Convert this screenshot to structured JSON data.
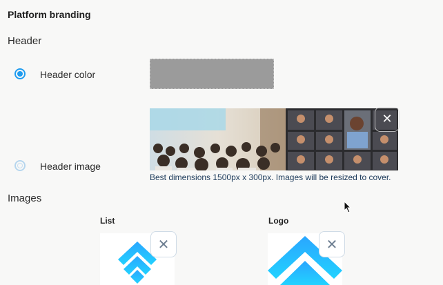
{
  "section": {
    "title": "Platform branding"
  },
  "header_section": {
    "title": "Header",
    "color_option": {
      "label": "Header color",
      "selected": true,
      "swatch": "#9b9b9b"
    },
    "image_option": {
      "label": "Header image",
      "selected": false
    },
    "image_hint": "Best dimensions 1500px x 300px. Images will be resized to cover.",
    "remove_icon": "close-icon"
  },
  "images_section": {
    "title": "Images",
    "list": {
      "label": "List",
      "remove_icon": "close-icon"
    },
    "logo": {
      "label": "Logo",
      "remove_icon": "close-icon"
    }
  },
  "colors": {
    "accent": "#1f9cf0",
    "logo_top": "#2aa6ff",
    "logo_bottom": "#22d2ff"
  }
}
